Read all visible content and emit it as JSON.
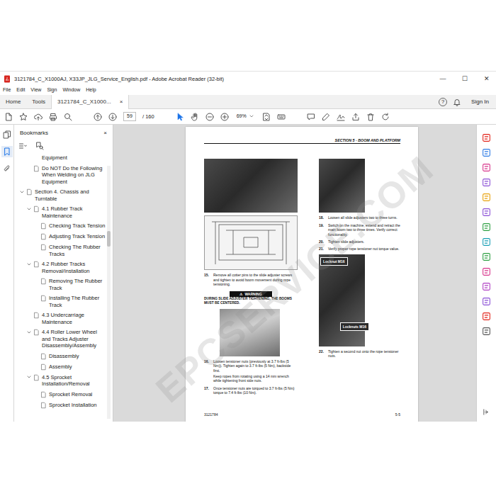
{
  "window": {
    "title": "3121784_C_X1000AJ, X33JP_JLG_Service_English.pdf - Adobe Acrobat Reader (32-bit)",
    "controls": [
      "—",
      "☐",
      "✕"
    ]
  },
  "menu": [
    "File",
    "Edit",
    "View",
    "Sign",
    "Window",
    "Help"
  ],
  "tabs": [
    {
      "label": "Home",
      "selected": false,
      "close": ""
    },
    {
      "label": "Tools",
      "selected": false,
      "close": ""
    },
    {
      "label": "3121784_C_X1000...",
      "selected": true,
      "close": "×"
    }
  ],
  "header_right": {
    "help": "?",
    "sign_in": "Sign In"
  },
  "toolbar": {
    "page": "59",
    "page_total": "/ 160",
    "zoom": "69%"
  },
  "bookmarks": {
    "title": "Bookmarks",
    "close": "×",
    "above": [
      {
        "label": "Equipment",
        "kind": "cut"
      },
      {
        "label": "Do NOT Do the Following When Welding on JLG Equipment",
        "kind": "page"
      }
    ],
    "items": [
      {
        "label": "Section 4. Chassis and Turntable",
        "kind": "page",
        "expanded": true,
        "children": [
          {
            "label": "4.1 Rubber Track Maintenance",
            "kind": "page",
            "expanded": true,
            "children": [
              {
                "label": "Checking Track Tension",
                "kind": "page"
              },
              {
                "label": "Adjusting Track Tension",
                "kind": "page"
              },
              {
                "label": "Checking The Rubber Tracks",
                "kind": "page"
              }
            ]
          },
          {
            "label": "4.2 Rubber Tracks Removal/Installation",
            "kind": "page",
            "expanded": true,
            "children": [
              {
                "label": "Removing The Rubber Track",
                "kind": "page"
              },
              {
                "label": "Installing The Rubber Track",
                "kind": "page"
              }
            ]
          },
          {
            "label": "4.3 Undercarriage Maintenance",
            "kind": "page"
          },
          {
            "label": "4.4 Roller Lower Wheel and Tracks Adjuster Disassembly/Assembly",
            "kind": "page",
            "expanded": true,
            "children": [
              {
                "label": "Disassembly",
                "kind": "page"
              },
              {
                "label": "Assembly",
                "kind": "page"
              }
            ]
          },
          {
            "label": "4.5 Sprocket Installation/Removal",
            "kind": "page",
            "expanded": true,
            "children": [
              {
                "label": "Sprocket Removal",
                "kind": "page"
              },
              {
                "label": "Sprocket Installation",
                "kind": "page"
              }
            ]
          }
        ]
      }
    ]
  },
  "document": {
    "header": "SECTION 5 - BOOM AND PLATFORM",
    "left": [
      {
        "kind": "photo"
      },
      {
        "kind": "drawing"
      },
      {
        "kind": "step",
        "number": "15.",
        "text": "Remove all cotter pins to the slide adjuster screws and tighten to avoid boom movement during rope tensioning."
      },
      {
        "kind": "warning",
        "symbol": "⚠",
        "label": "WARNING",
        "text": "DURING SLIDE ADJUSTER TIGHTENING, THE BOOMS MUST BE CENTERED."
      },
      {
        "kind": "photo"
      },
      {
        "kind": "step",
        "number": "16.",
        "text": "Loosen tensioner nuts (previously at 3.7 ft-lbs (5 Nm)). Tighten again to 3.7 ft-lbs (5 Nm), backside first.",
        "note": "Keep ropes from rotating using a 14 mm wrench while tightening front side nuts."
      },
      {
        "kind": "step",
        "number": "17.",
        "text": "Once tensioner nuts are torqued to 3.7 ft-lbs (5 Nm) torque to 7.4 ft-lbs (10 Nm)."
      }
    ],
    "right": [
      {
        "kind": "photo"
      },
      {
        "kind": "step",
        "number": "18.",
        "text": "Loosen all slide adjusters two to three turns."
      },
      {
        "kind": "step",
        "number": "19.",
        "text": "Switch on the machine, extend and retract the main boom two to three times. Verify correct functionality."
      },
      {
        "kind": "step",
        "number": "20.",
        "text": "Tighten slide adjusters."
      },
      {
        "kind": "step",
        "number": "21.",
        "text": "Verify proper rope tensioner nut torque value."
      },
      {
        "kind": "photo",
        "labels": [
          "Locknut M16",
          "Locknuts M16"
        ]
      },
      {
        "kind": "step",
        "number": "22.",
        "text": "Tighten a second nut onto the rope tensioner nuts."
      }
    ],
    "footer_left": "3121784",
    "footer_right": "5-5",
    "watermark": "EPCSERVICE.COM"
  }
}
